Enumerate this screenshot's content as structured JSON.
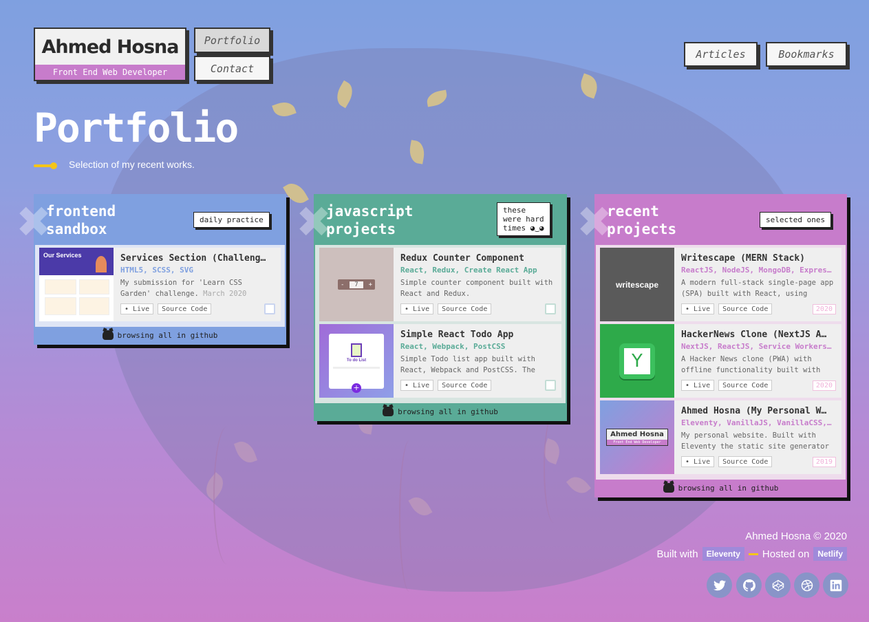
{
  "header": {
    "name": "Ahmed Hosna",
    "role": "Front End Web Developer",
    "nav": {
      "portfolio": "Portfolio",
      "contact": "Contact",
      "articles": "Articles",
      "bookmarks": "Bookmarks"
    }
  },
  "hero": {
    "title": "Portfolio",
    "subtitle": "Selection of my recent works."
  },
  "cards": {
    "frontend": {
      "title": "frontend\nsandbox",
      "tag": "daily practice",
      "footer": "browsing all in github",
      "items": [
        {
          "title": "Services Section (Challeng…",
          "tags": "HTML5, SCSS, SVG",
          "desc": "My submission for 'Learn CSS Garden' challenge.",
          "date": "March 2020",
          "live": "• Live",
          "source": "Source Code",
          "thumb_heading": "Our Services"
        }
      ]
    },
    "javascript": {
      "title": "javascript\nprojects",
      "tag": "these\nwere hard\ntimes ◕‿◕",
      "footer": "browsing all in github",
      "items": [
        {
          "title": "Redux Counter Component",
          "tags": "React, Redux, Create React App",
          "desc": "Simple counter component built with React and Redux.",
          "live": "• Live",
          "source": "Source Code",
          "counter_minus": "-",
          "counter_value": "7",
          "counter_plus": "+"
        },
        {
          "title": "Simple React Todo App",
          "tags": "React, Webpack, PostCSS",
          "desc": "Simple Todo list app built with React, Webpack and PostCSS. The",
          "live": "• Live",
          "source": "Source Code",
          "thumb_label": "To do List"
        }
      ]
    },
    "recent": {
      "title": "recent\nprojects",
      "tag": "selected ones",
      "footer": "browsing all in github",
      "items": [
        {
          "title": "Writescape (MERN Stack)",
          "tags": "ReactJS, NodeJS, MongoDB, Express…",
          "desc": "A modern full-stack single-page app (SPA) built with React, using",
          "live": "• Live",
          "source": "Source Code",
          "year": "2020",
          "thumb_label": "writescape"
        },
        {
          "title": "HackerNews Clone (NextJS A…",
          "tags": "NextJS, ReactJS, Service Workers,…",
          "desc": "A Hacker News clone (PWA) with offline functionality built with",
          "live": "• Live",
          "source": "Source Code",
          "year": "2020",
          "thumb_label": "Y"
        },
        {
          "title": "Ahmed Hosna (My Personal W…",
          "tags": "Eleventy, VanillaJS, VanillaCSS, …",
          "desc": "My personal website. Built with Eleventy the static site generator",
          "live": "• Live",
          "source": "Source Code",
          "year": "2019",
          "thumb_name": "Ahmed Hosna",
          "thumb_role": "Front End Web Developer"
        }
      ]
    }
  },
  "footer": {
    "copyright": "Ahmed Hosna © 2020",
    "built_with": "Built with",
    "eleventy": "Eleventy",
    "hosted_on": "Hosted on",
    "netlify": "Netlify",
    "social": [
      "twitter-icon",
      "github-icon",
      "codepen-icon",
      "dribbble-icon",
      "linkedin-icon"
    ]
  },
  "colors": {
    "frontend": "#7fa0e0",
    "javascript": "#5aab97",
    "recent": "#c77ccb",
    "accent": "#f5c518"
  }
}
